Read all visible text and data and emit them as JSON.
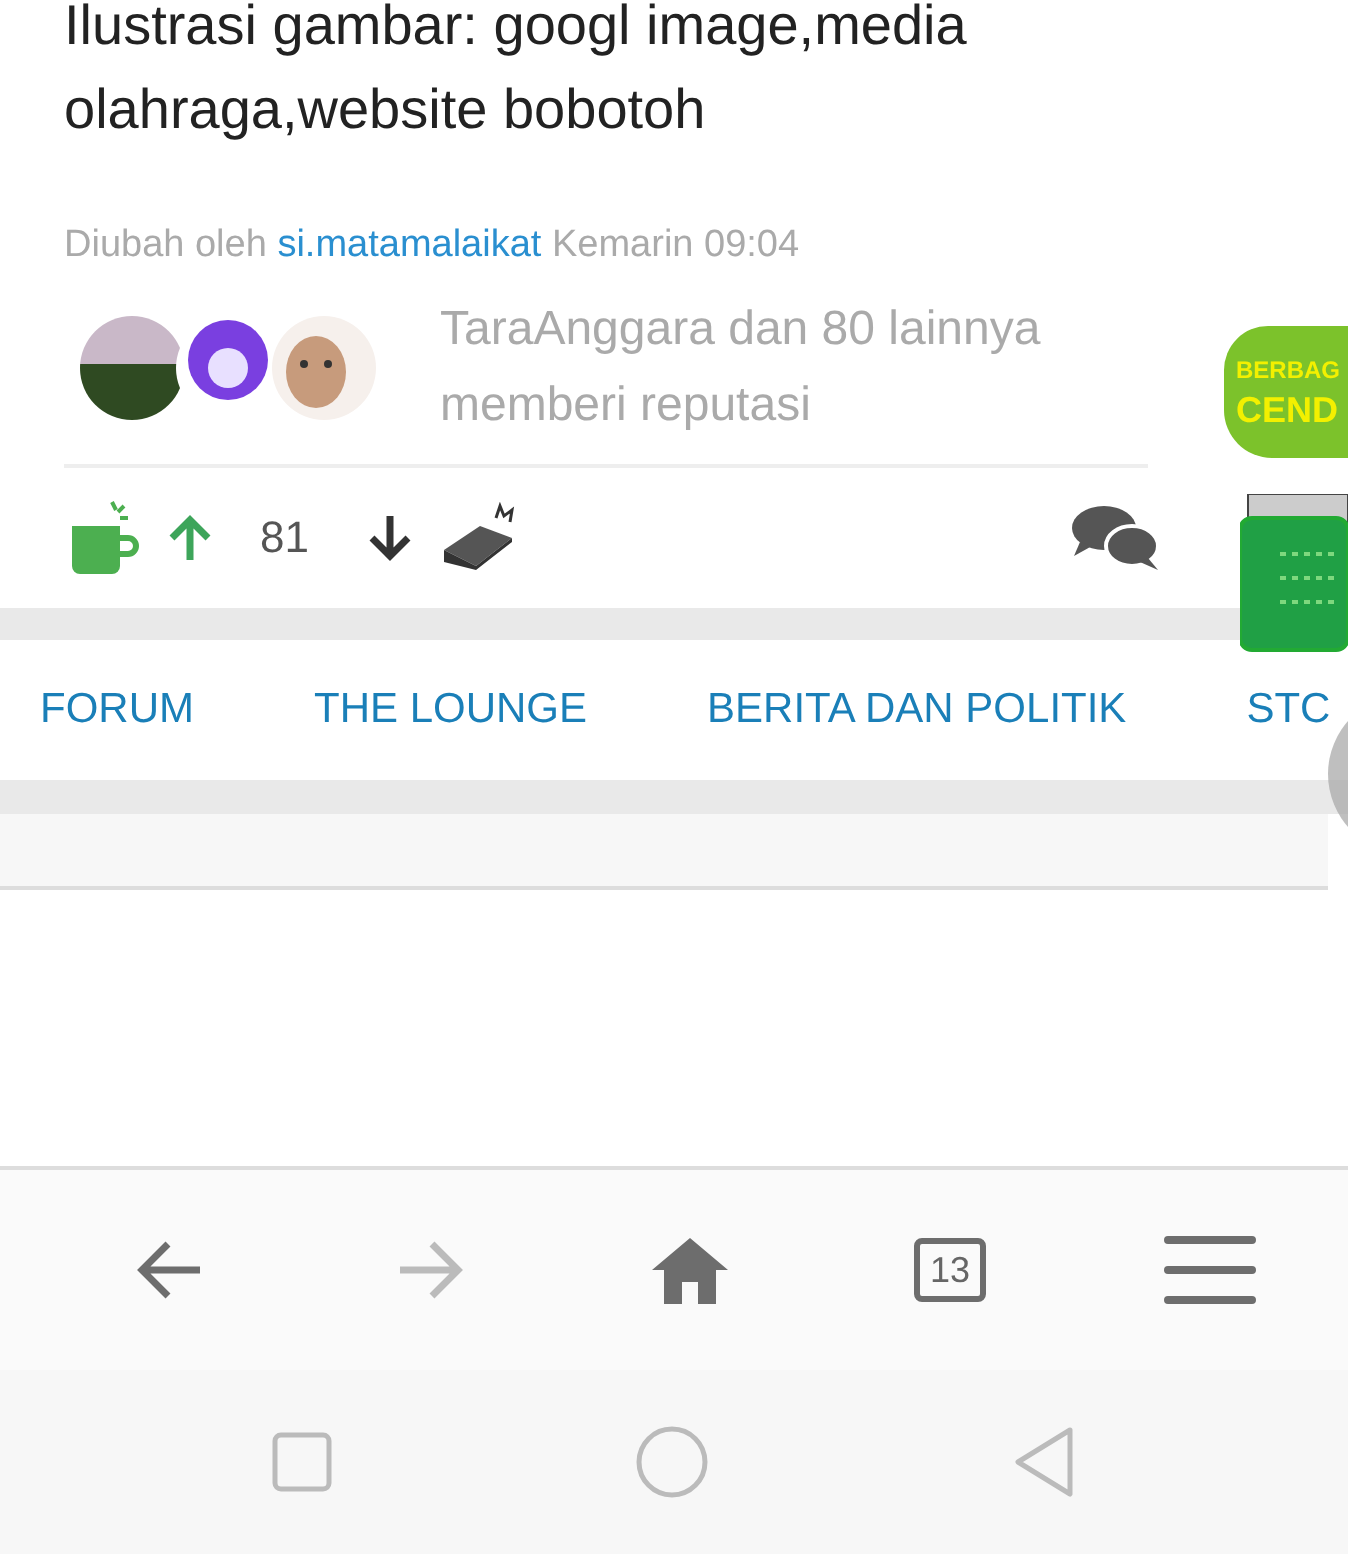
{
  "post": {
    "caption": "Ilustrasi gambar: googl image,media olahraga,website bobotoh",
    "edit_note": {
      "prefix": "Diubah oleh",
      "user": "si.matamalaikat",
      "time": "Kemarin 09:04"
    },
    "reputation": {
      "text": "TaraAnggara dan 80 lainnya memberi reputasi"
    },
    "votes": {
      "count": "81"
    }
  },
  "sticker": {
    "line_1": "BERBAG",
    "line_2": "CEND"
  },
  "categories": [
    {
      "label": "FORUM"
    },
    {
      "label": "THE LOUNGE"
    },
    {
      "label": "BERITA DAN POLITIK"
    },
    {
      "label": "STC"
    }
  ],
  "browser_bar": [
    {
      "kind": "back",
      "disabled": false
    },
    {
      "kind": "forward",
      "disabled": true
    },
    {
      "kind": "home",
      "disabled": false
    },
    {
      "kind": "tabs",
      "count": "13",
      "disabled": false
    },
    {
      "kind": "menu",
      "disabled": false
    }
  ],
  "system_nav": [
    {
      "kind": "recents"
    },
    {
      "kind": "home"
    },
    {
      "kind": "back"
    }
  ]
}
